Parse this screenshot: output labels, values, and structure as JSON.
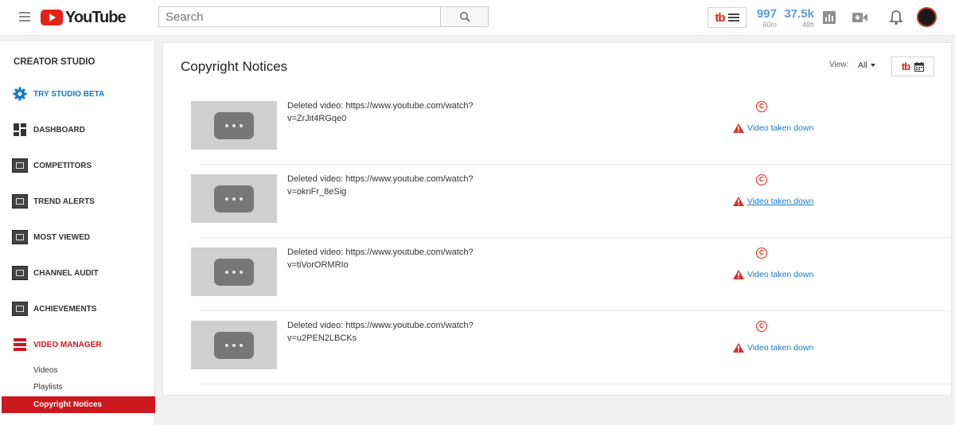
{
  "topbar": {
    "logo_text": "YouTube",
    "search_placeholder": "Search",
    "extension_logo": "tb",
    "stats": [
      {
        "value": "997",
        "period": "60m"
      },
      {
        "value": "37.5k",
        "period": "48h"
      }
    ]
  },
  "sidebar": {
    "title": "CREATOR STUDIO",
    "items": [
      {
        "label": "TRY STUDIO BETA",
        "icon": "gear-icon"
      },
      {
        "label": "DASHBOARD",
        "icon": "dashboard-icon"
      },
      {
        "label": "COMPETITORS",
        "icon": "tubebuddy-badge-icon"
      },
      {
        "label": "TREND ALERTS",
        "icon": "tubebuddy-badge-icon"
      },
      {
        "label": "MOST VIEWED",
        "icon": "tubebuddy-badge-icon"
      },
      {
        "label": "CHANNEL AUDIT",
        "icon": "tubebuddy-badge-icon"
      },
      {
        "label": "ACHIEVEMENTS",
        "icon": "tubebuddy-badge-icon"
      },
      {
        "label": "VIDEO MANAGER",
        "icon": "video-manager-icon"
      }
    ],
    "subitems": [
      "Videos",
      "Playlists",
      "Copyright Notices"
    ]
  },
  "main": {
    "title": "Copyright Notices",
    "view_label": "View:",
    "view_value": "All",
    "rows": [
      {
        "title_line1": "Deleted video: https://www.youtube.com/watch?",
        "title_line2": "v=ZrJit4RGqe0",
        "status": "Video taken down"
      },
      {
        "title_line1": "Deleted video: https://www.youtube.com/watch?",
        "title_line2": "v=oknFr_8eSig",
        "status": "Video taken down"
      },
      {
        "title_line1": "Deleted video: https://www.youtube.com/watch?",
        "title_line2": "v=tiVorORMRIo",
        "status": "Video taken down"
      },
      {
        "title_line1": "Deleted video: https://www.youtube.com/watch?",
        "title_line2": "v=u2PEN2LBCKs",
        "status": "Video taken down"
      }
    ]
  },
  "colors": {
    "brand_red": "#e62117",
    "link_blue": "#167ac6",
    "active_red": "#cc181e"
  }
}
